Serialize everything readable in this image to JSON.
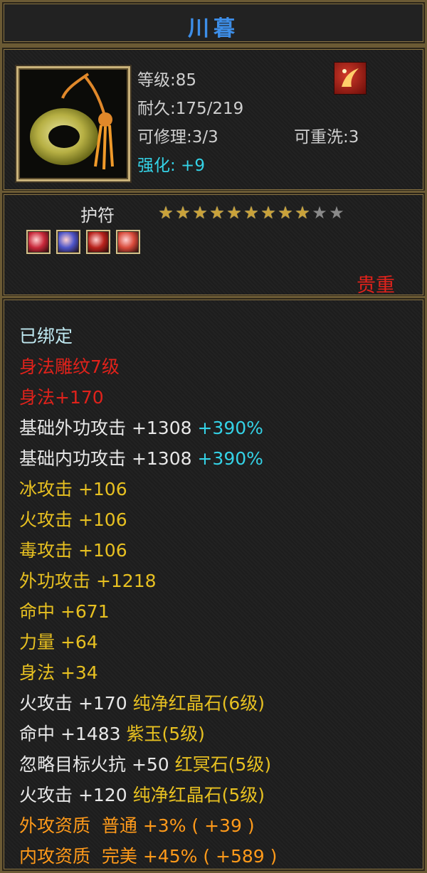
{
  "item": {
    "name": "川暮",
    "level_label": "等级:85",
    "durability_label": "耐久:175/219",
    "repair_label": "可修理:3/3",
    "rewash_label": "可重洗:3",
    "enhance_label": "强化: +9",
    "type": "护符",
    "stars_lit": 9,
    "stars_total": 11,
    "rarity": "贵重",
    "gems": [
      {
        "icon": "red-gem-icon",
        "color": "#c8283a"
      },
      {
        "icon": "purple-gem-icon",
        "color": "#4c54c8"
      },
      {
        "icon": "red-crystal-icon",
        "color": "#b8221c"
      },
      {
        "icon": "jade-gem-icon",
        "color": "#d84a3a"
      }
    ]
  },
  "colors": {
    "white": "#e8e8e8",
    "cyan_white": "#bfe8f0",
    "red": "#e0221b",
    "yellow": "#e7c021",
    "orange": "#ff9a1a",
    "gray": "#cfcfcf",
    "cyan": "#34d2e6"
  },
  "attributes": [
    {
      "parts": [
        {
          "text": "已绑定",
          "color": "#bfe8f0"
        }
      ]
    },
    {
      "parts": [
        {
          "text": "身法雕纹7级",
          "color": "#e0221b"
        }
      ]
    },
    {
      "parts": [
        {
          "text": "身法+170",
          "color": "#e0221b"
        }
      ]
    },
    {
      "parts": [
        {
          "text": "基础外功攻击 +1308 ",
          "color": "#e8e8e8"
        },
        {
          "text": "+390%",
          "color": "#34d2e6"
        }
      ]
    },
    {
      "parts": [
        {
          "text": "基础内功攻击 +1308 ",
          "color": "#e8e8e8"
        },
        {
          "text": "+390%",
          "color": "#34d2e6"
        }
      ]
    },
    {
      "parts": [
        {
          "text": "冰攻击 +106",
          "color": "#e7c021"
        }
      ]
    },
    {
      "parts": [
        {
          "text": "火攻击 +106",
          "color": "#e7c021"
        }
      ]
    },
    {
      "parts": [
        {
          "text": "毒攻击 +106",
          "color": "#e7c021"
        }
      ]
    },
    {
      "parts": [
        {
          "text": "外功攻击 +1218",
          "color": "#e7c021"
        }
      ]
    },
    {
      "parts": [
        {
          "text": "命中 +671",
          "color": "#e7c021"
        }
      ]
    },
    {
      "parts": [
        {
          "text": "力量 +64",
          "color": "#e7c021"
        }
      ]
    },
    {
      "parts": [
        {
          "text": "身法 +34",
          "color": "#e7c021"
        }
      ]
    },
    {
      "parts": [
        {
          "text": "火攻击 +170 ",
          "color": "#e8e8e8"
        },
        {
          "text": "纯净红晶石(6级)",
          "color": "#e7c021"
        }
      ]
    },
    {
      "parts": [
        {
          "text": "命中 +1483 ",
          "color": "#e8e8e8"
        },
        {
          "text": "紫玉(5级)",
          "color": "#e7c021"
        }
      ]
    },
    {
      "parts": [
        {
          "text": "忽略目标火抗 +50 ",
          "color": "#e8e8e8"
        },
        {
          "text": "红冥石(5级)",
          "color": "#e7c021"
        }
      ]
    },
    {
      "parts": [
        {
          "text": "火攻击 +120 ",
          "color": "#e8e8e8"
        },
        {
          "text": "纯净红晶石(5级)",
          "color": "#e7c021"
        }
      ]
    },
    {
      "parts": [
        {
          "text": "外攻资质  ",
          "color": "#ff9a1a"
        },
        {
          "text": "普通 +3% ( +39 )",
          "color": "#ff9a1a"
        }
      ]
    },
    {
      "parts": [
        {
          "text": "内攻资质  ",
          "color": "#ff9a1a"
        },
        {
          "text": "完美 +45% ( +589 )",
          "color": "#ff9a1a"
        }
      ]
    }
  ]
}
